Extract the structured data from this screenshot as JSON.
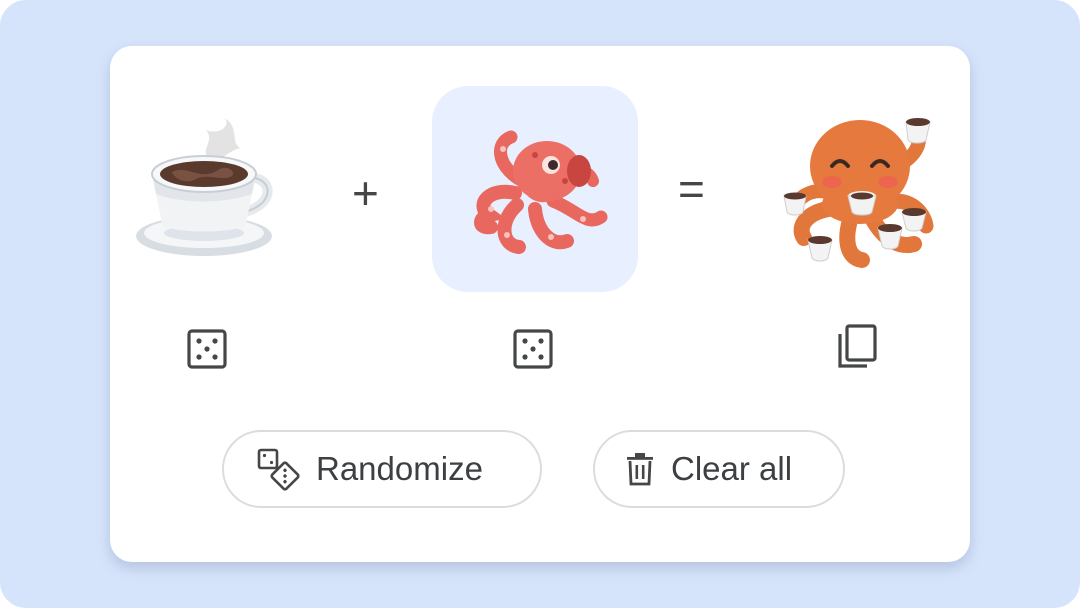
{
  "emoji_kitchen": {
    "left_emoji": {
      "name": "hot-beverage"
    },
    "middle_emoji": {
      "name": "octopus"
    },
    "result_emoji": {
      "name": "octopus-with-coffee-cups"
    },
    "plus_sign": "+",
    "equals_sign": "=",
    "icons": {
      "left_randomize": "dice-icon",
      "middle_randomize": "dice-icon",
      "copy_result": "copy-icon"
    }
  },
  "actions": {
    "randomize_label": "Randomize",
    "clear_label": "Clear all",
    "randomize_icon": "dice-pair-icon",
    "clear_icon": "trash-icon"
  },
  "colors": {
    "background": "#d6e4fb",
    "card": "#ffffff",
    "selected_slot": "#e8effe",
    "icon": "#444746",
    "button_border": "#dadce0"
  }
}
